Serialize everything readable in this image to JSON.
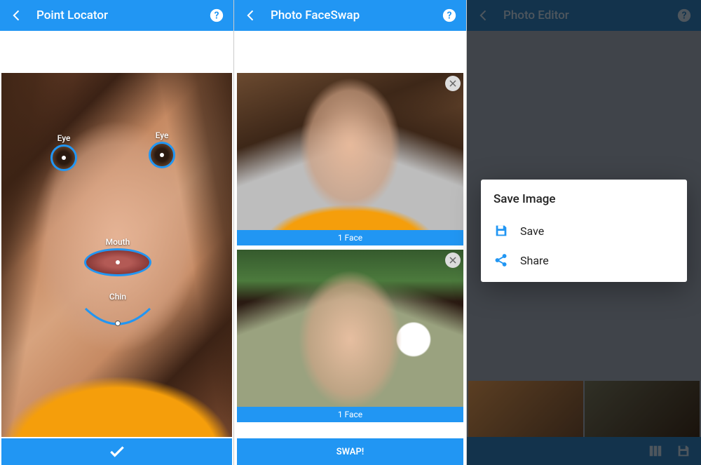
{
  "panes": {
    "locator": {
      "title": "Point Locator",
      "markers": {
        "eye_left": "Eye",
        "eye_right": "Eye",
        "mouth": "Mouth",
        "chin": "Chin"
      }
    },
    "faceswap": {
      "title": "Photo FaceSwap",
      "thumbs": [
        {
          "face_count_label": "1 Face"
        },
        {
          "face_count_label": "1 Face"
        }
      ],
      "swap_button": "SWAP!"
    },
    "editor": {
      "title": "Photo Editor",
      "dialog": {
        "heading": "Save Image",
        "save_label": "Save",
        "share_label": "Share"
      }
    }
  },
  "colors": {
    "primary": "#2196F3",
    "primary_dim": "#2a72a8"
  }
}
